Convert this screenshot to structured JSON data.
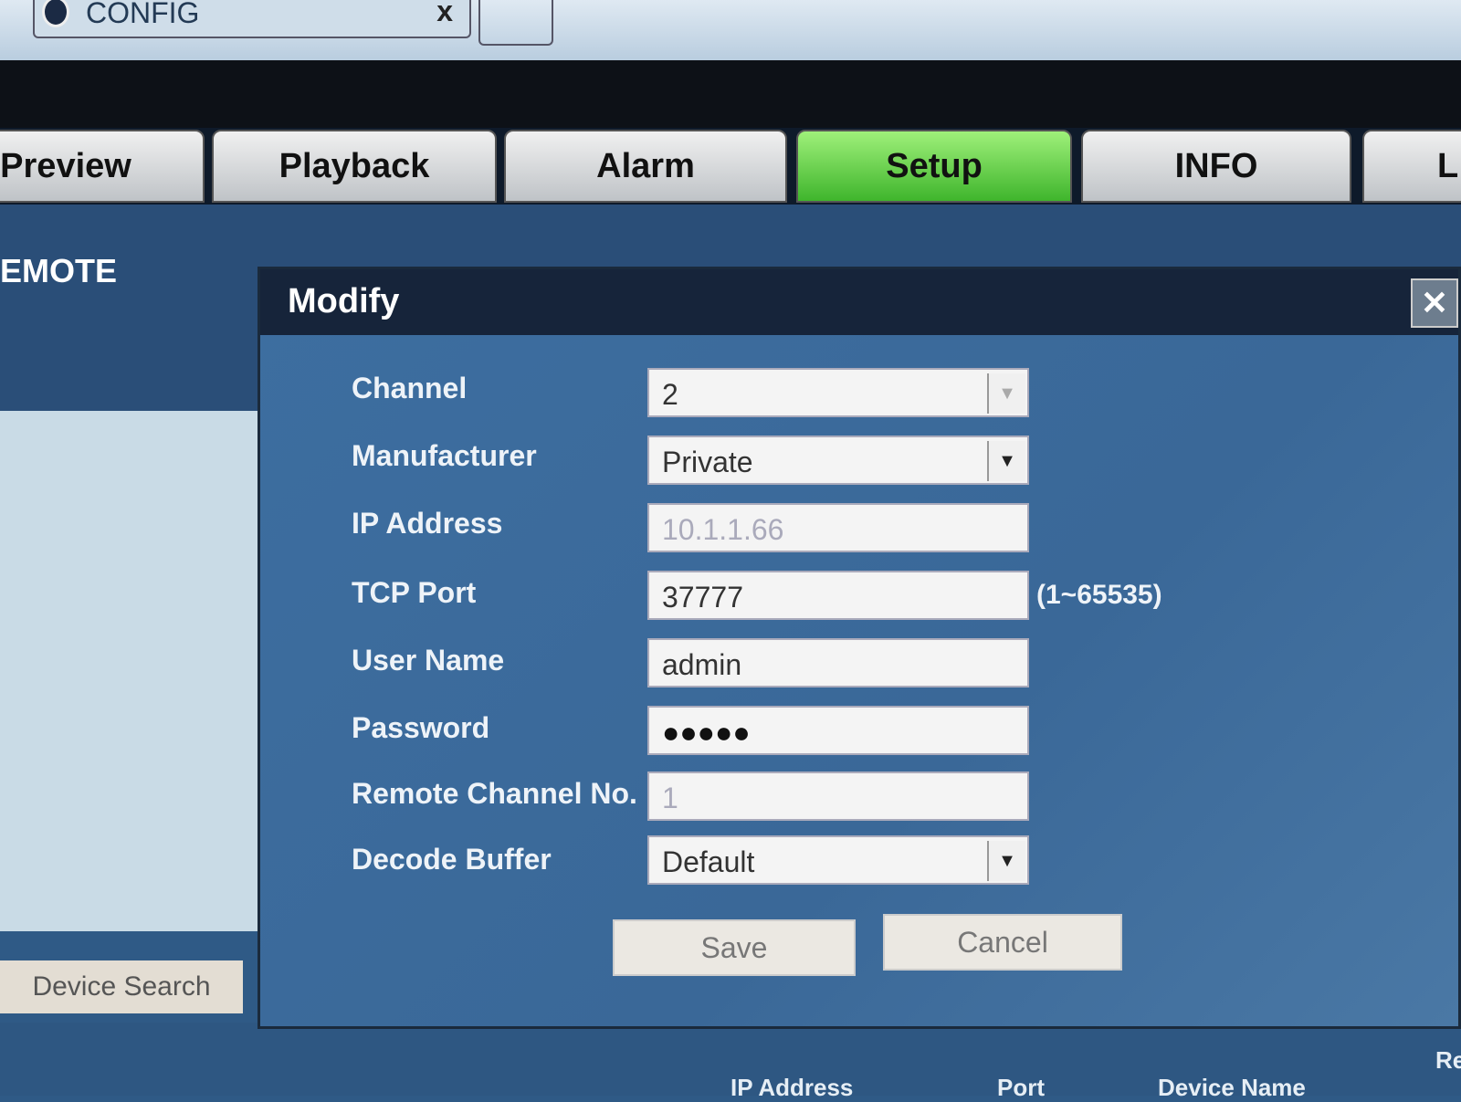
{
  "browser": {
    "tab_title": "CONFIG",
    "tab_close": "x"
  },
  "nav": {
    "tabs": [
      {
        "label": "Preview"
      },
      {
        "label": "Playback"
      },
      {
        "label": "Alarm"
      },
      {
        "label": "Setup",
        "active": true
      },
      {
        "label": "INFO"
      },
      {
        "label": "L"
      }
    ]
  },
  "section_title": "EMOTE",
  "left": {
    "device_search": "Device Search"
  },
  "table": {
    "headers": [
      "IP Address",
      "Port",
      "Device Name",
      "Re"
    ]
  },
  "dialog": {
    "title": "Modify",
    "close": "✕",
    "fields": [
      {
        "label": "Channel",
        "value": "2",
        "type": "select"
      },
      {
        "label": "Manufacturer",
        "value": "Private",
        "type": "select"
      },
      {
        "label": "IP Address",
        "value": "10.1.1.66",
        "disabled": true
      },
      {
        "label": "TCP Port",
        "value": "37777",
        "hint": "(1~65535)"
      },
      {
        "label": "User Name",
        "value": "admin"
      },
      {
        "label": "Password",
        "value": "●●●●●"
      },
      {
        "label": "Remote Channel No.",
        "value": "1",
        "disabled": true
      },
      {
        "label": "Decode Buffer",
        "value": "Default",
        "type": "select"
      }
    ],
    "save": "Save",
    "cancel": "Cancel"
  },
  "colors": {
    "active_tab": "#5fd13f",
    "dialog_bg": "#3d6ea0",
    "header": "#16243a"
  }
}
